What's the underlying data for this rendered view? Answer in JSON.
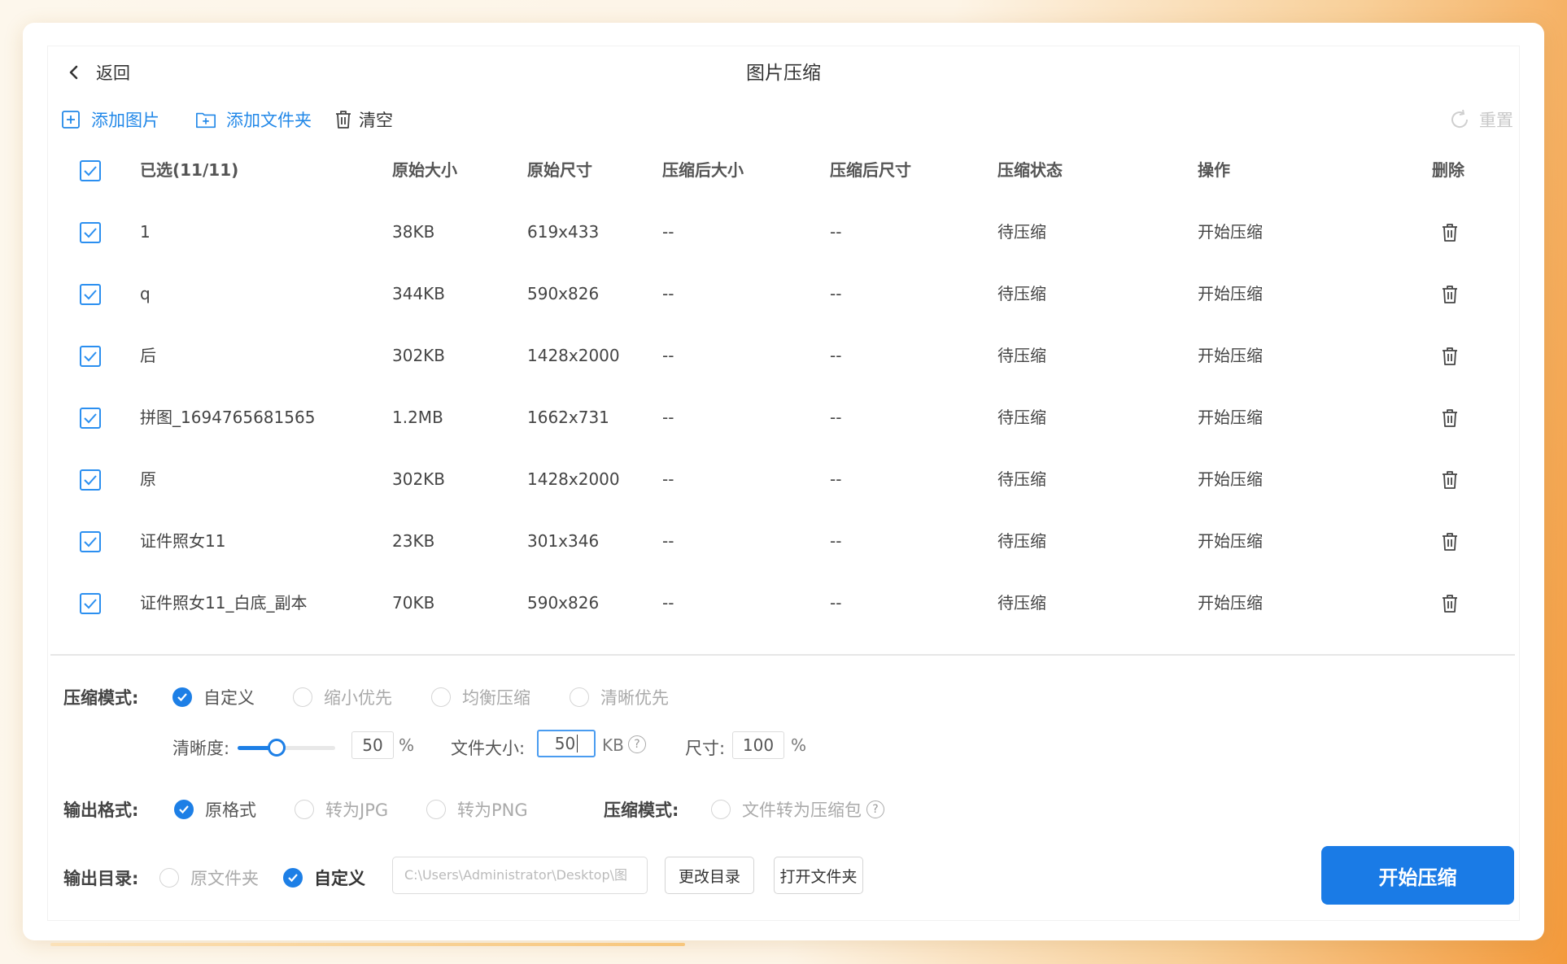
{
  "header": {
    "back_label": "返回",
    "title": "图片压缩"
  },
  "toolbar": {
    "add_image": "添加图片",
    "add_folder": "添加文件夹",
    "clear": "清空",
    "reset": "重置"
  },
  "table": {
    "columns": {
      "selected": "已选(11/11)",
      "orig_size": "原始大小",
      "orig_dim": "原始尺寸",
      "comp_size": "压缩后大小",
      "comp_dim": "压缩后尺寸",
      "status": "压缩状态",
      "action": "操作",
      "delete": "删除"
    },
    "rows": [
      {
        "name": "1",
        "orig_size": "38KB",
        "orig_dim": "619x433",
        "comp_size": "--",
        "comp_dim": "--",
        "status": "待压缩",
        "action": "开始压缩"
      },
      {
        "name": "q",
        "orig_size": "344KB",
        "orig_dim": "590x826",
        "comp_size": "--",
        "comp_dim": "--",
        "status": "待压缩",
        "action": "开始压缩"
      },
      {
        "name": "后",
        "orig_size": "302KB",
        "orig_dim": "1428x2000",
        "comp_size": "--",
        "comp_dim": "--",
        "status": "待压缩",
        "action": "开始压缩"
      },
      {
        "name": "拼图_1694765681565",
        "orig_size": "1.2MB",
        "orig_dim": "1662x731",
        "comp_size": "--",
        "comp_dim": "--",
        "status": "待压缩",
        "action": "开始压缩"
      },
      {
        "name": "原",
        "orig_size": "302KB",
        "orig_dim": "1428x2000",
        "comp_size": "--",
        "comp_dim": "--",
        "status": "待压缩",
        "action": "开始压缩"
      },
      {
        "name": "证件照女11",
        "orig_size": "23KB",
        "orig_dim": "301x346",
        "comp_size": "--",
        "comp_dim": "--",
        "status": "待压缩",
        "action": "开始压缩"
      },
      {
        "name": "证件照女11_白底_副本",
        "orig_size": "70KB",
        "orig_dim": "590x826",
        "comp_size": "--",
        "comp_dim": "--",
        "status": "待压缩",
        "action": "开始压缩"
      }
    ]
  },
  "options": {
    "compress_mode_label": "压缩模式:",
    "modes": [
      "自定义",
      "缩小优先",
      "均衡压缩",
      "清晰优先"
    ],
    "selected_mode": "自定义",
    "clarity_label": "清晰度:",
    "clarity_value": "50",
    "clarity_percent": 0.4,
    "percent_unit": "%",
    "filesize_label": "文件大小:",
    "filesize_value": "50",
    "filesize_unit": "KB",
    "dim_label": "尺寸:",
    "dim_value": "100",
    "output_format_label": "输出格式:",
    "formats": [
      "原格式",
      "转为JPG",
      "转为PNG"
    ],
    "selected_format": "原格式",
    "zip_mode_label": "压缩模式:",
    "zip_option": "文件转为压缩包",
    "output_dir_label": "输出目录:",
    "dir_options": [
      "原文件夹",
      "自定义"
    ],
    "selected_dir": "自定义",
    "dir_path": "C:\\Users\\Administrator\\Desktop\\图",
    "change_dir": "更改目录",
    "open_folder": "打开文件夹",
    "start_button": "开始压缩"
  },
  "colors": {
    "accent": "#1a7be6",
    "link": "#2288e8"
  }
}
